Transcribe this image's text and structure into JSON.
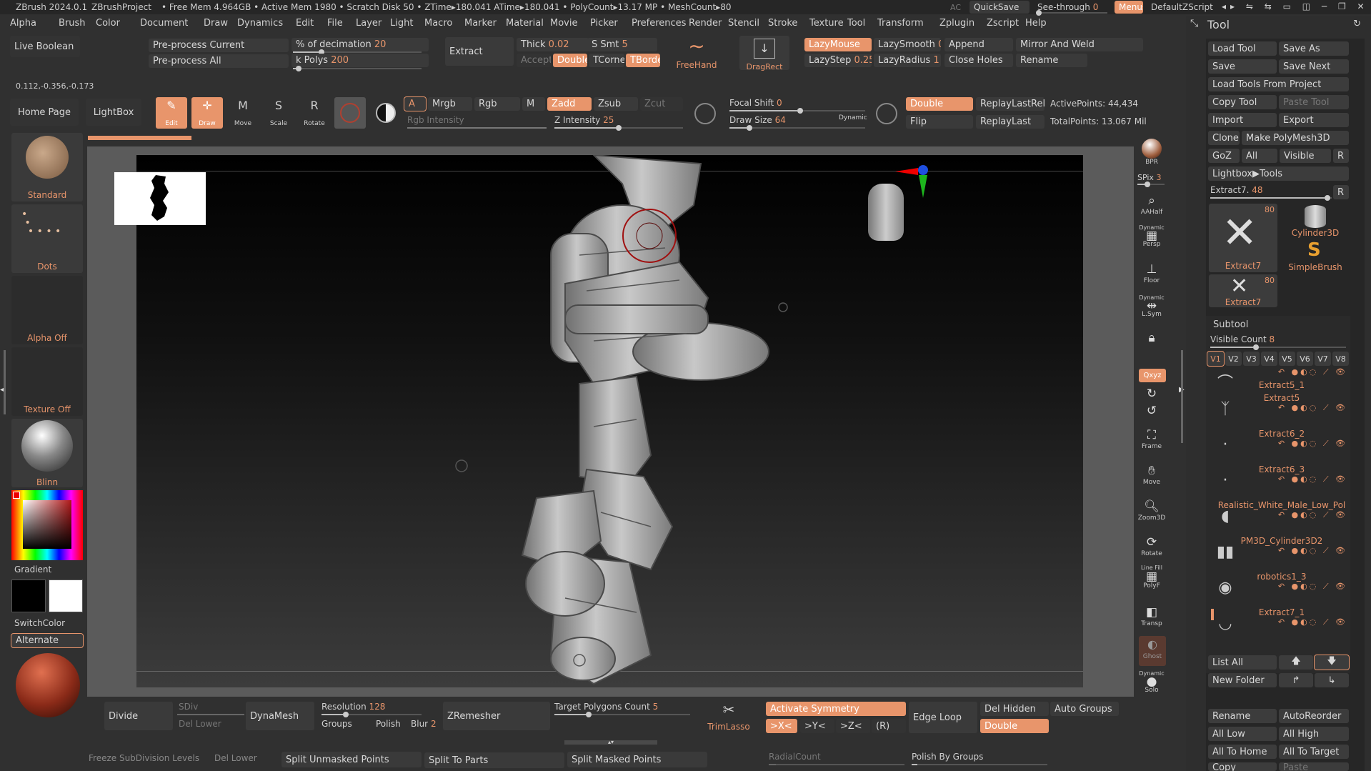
{
  "titlebar": {
    "app": "ZBrush 2024.0.1",
    "project": "ZBrushProject",
    "stats": "• Free Mem 4.964GB • Active Mem 1980 • Scratch Disk 50 • ZTime▸180.041 ATime▸180.041 • PolyCount▸13.17 MP • MeshCount▸80",
    "ac": "AC",
    "quicksave": "QuickSave",
    "seethrough": "See-through",
    "seethrough_val": "0",
    "menus": "Menus",
    "script": "DefaultZScript"
  },
  "menubar": [
    "Alpha",
    "Brush",
    "Color",
    "Document",
    "Draw",
    "Dynamics",
    "Edit",
    "File",
    "Layer",
    "Light",
    "Macro",
    "Marker",
    "Material",
    "Movie",
    "Picker",
    "Preferences",
    "Render",
    "Stencil",
    "Stroke",
    "Texture",
    "Tool",
    "Transform",
    "Zplugin",
    "Zscript",
    "Help"
  ],
  "toolbar1": {
    "live_boolean": "Live Boolean",
    "preprocess_current": "Pre-process Current",
    "preprocess_all": "Pre-process All",
    "decimation_label": "% of decimation",
    "decimation_val": "20",
    "kpolys_label": "k Polys",
    "kpolys_val": "200",
    "extract": "Extract",
    "accept": "Accept",
    "thick_label": "Thick",
    "thick_val": "0.02",
    "ssmt_label": "S Smt",
    "ssmt_val": "5",
    "double": "Double",
    "tcorne": "TCorne",
    "tborde": "TBorde",
    "freehand": "FreeHand",
    "dragrect": "DragRect",
    "lazymouse": "LazyMouse",
    "lazysmooth_label": "LazySmooth",
    "lazysmooth_val": "0",
    "lazystep_label": "LazyStep",
    "lazystep_val": "0.25",
    "lazyradius_label": "LazyRadius",
    "lazyradius_val": "1",
    "append": "Append",
    "close_holes": "Close Holes",
    "mirror_weld": "Mirror And Weld",
    "rename": "Rename"
  },
  "coords": "0.112,-0.356,-0.173",
  "toolbar2": {
    "home": "Home Page",
    "lightbox": "LightBox",
    "edit": "Edit",
    "draw": "Draw",
    "move": "Move",
    "scale": "Scale",
    "rotate": "Rotate",
    "a": "A",
    "mrgb": "Mrgb",
    "rgb": "Rgb",
    "m": "M",
    "rgb_intensity": "Rgb Intensity",
    "zadd": "Zadd",
    "zsub": "Zsub",
    "zcut": "Zcut",
    "z_intensity_label": "Z Intensity",
    "z_intensity_val": "25",
    "focal_label": "Focal Shift",
    "focal_val": "0",
    "drawsize_label": "Draw Size",
    "drawsize_val": "64",
    "dynamic": "Dynamic",
    "double": "Double",
    "flip": "Flip",
    "replaylastrel": "ReplayLastRel",
    "replaylast": "ReplayLast",
    "activepoints": "ActivePoints: 44,434",
    "totalpoints": "TotalPoints: 13.067 Mil"
  },
  "leftshelf": {
    "standard": "Standard",
    "dots": "Dots",
    "alpha_off": "Alpha Off",
    "texture_off": "Texture Off",
    "blinn": "Blinn",
    "gradient": "Gradient",
    "switchcolor": "SwitchColor",
    "alternate": "Alternate"
  },
  "rightshelf": {
    "bpr": "BPR",
    "spix_label": "SPix",
    "spix_val": "3",
    "aahalf": "AAHalf",
    "dynamic": "Dynamic",
    "persp": "Persp",
    "floor": "Floor",
    "lsym": "L.Sym",
    "qxyz": "Qxyz",
    "frame": "Frame",
    "move": "Move",
    "zoom3d": "Zoom3D",
    "rotate": "Rotate",
    "linefill": "Line Fill",
    "polyf": "PolyF",
    "transp": "Transp",
    "ghost": "Ghost",
    "solo": "Solo"
  },
  "toolpanel": {
    "title": "Tool",
    "load_tool": "Load Tool",
    "save_as": "Save As",
    "save": "Save",
    "save_next": "Save Next",
    "load_from_project": "Load Tools From Project",
    "copy_tool": "Copy Tool",
    "paste_tool": "Paste Tool",
    "import": "Import",
    "export": "Export",
    "clone": "Clone",
    "make_polymesh": "Make PolyMesh3D",
    "goz": "GoZ",
    "all": "All",
    "visible": "Visible",
    "r": "R",
    "lightbox_tools": "Lightbox▶Tools",
    "extract_label": "Extract7.",
    "extract_val": "48",
    "thumbs": [
      {
        "name": "Extract7",
        "count": "80"
      },
      {
        "name": "Cylinder3D",
        "count": ""
      },
      {
        "name": "SimpleBrush",
        "count": ""
      },
      {
        "name": "Extract7",
        "count": "80"
      }
    ],
    "subtool": "Subtool",
    "visible_count_label": "Visible Count",
    "visible_count_val": "8",
    "versions": [
      "V1",
      "V2",
      "V3",
      "V4",
      "V5",
      "V6",
      "V7",
      "V8"
    ],
    "subtools": [
      "Extract5_1",
      "Extract5",
      "Extract6_2",
      "Extract6_3",
      "Realistic_White_Male_Low_Pol",
      "PM3D_Cylinder3D2",
      "robotics1_3",
      "Extract7_1"
    ],
    "list_all": "List All",
    "new_folder": "New Folder",
    "rename": "Rename",
    "autoreorder": "AutoReorder",
    "all_low": "All Low",
    "all_high": "All High",
    "all_to_home": "All To Home",
    "all_to_target": "All To Target",
    "copy": "Copy",
    "paste": "Paste"
  },
  "bottombar": {
    "divide": "Divide",
    "sdiv": "SDiv",
    "del_lower": "Del Lower",
    "dynamesh": "DynaMesh",
    "resolution_label": "Resolution",
    "resolution_val": "128",
    "groups": "Groups",
    "polish": "Polish",
    "blur_label": "Blur",
    "blur_val": "2",
    "zremesher": "ZRemesher",
    "target_poly_label": "Target Polygons Count",
    "target_poly_val": "5",
    "trimlasso": "TrimLasso",
    "activate_symmetry": "Activate Symmetry",
    "x": ">X<",
    "y": ">Y<",
    "z": ">Z<",
    "rsym": "(R)",
    "edge_loop": "Edge Loop",
    "del_hidden": "Del Hidden",
    "auto_groups": "Auto Groups",
    "double": "Double",
    "freeze_subdiv": "Freeze SubDivision Levels",
    "del_lower2": "Del Lower",
    "split_unmasked": "Split Unmasked Points",
    "split_to_parts": "Split To Parts",
    "split_masked": "Split Masked Points",
    "radialcount": "RadialCount",
    "polish_by_groups": "Polish By Groups"
  },
  "colors": {
    "accent": "#e8956b",
    "bg": "#303030",
    "canvas_top": "#000000",
    "canvas_bottom": "#4a4a4a"
  }
}
